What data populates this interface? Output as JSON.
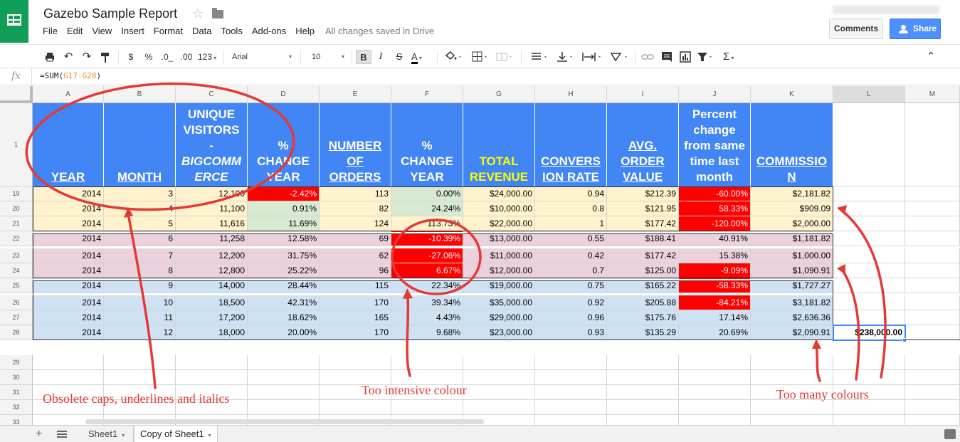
{
  "doc": {
    "title": "Gazebo Sample Report",
    "menu": [
      "File",
      "Edit",
      "View",
      "Insert",
      "Format",
      "Data",
      "Tools",
      "Add-ons",
      "Help"
    ],
    "save_status": "All changes saved in Drive",
    "comments_label": "Comments",
    "share_label": "Share"
  },
  "toolbar": {
    "currency": "$",
    "percent": "%",
    "dec_less": ".0_",
    "dec_more": ".00",
    "more_formats": "123",
    "font": "Arial",
    "font_size": "10",
    "bold": "B",
    "italic": "I",
    "strike": "S",
    "text_color": "A"
  },
  "formula": {
    "fx": "fx",
    "prefix": "=SUM(",
    "ref": "G17:G28",
    "suffix": ")"
  },
  "columns": [
    "A",
    "B",
    "C",
    "D",
    "E",
    "F",
    "G",
    "H",
    "I",
    "J",
    "K",
    "L",
    "M"
  ],
  "header_row": {
    "number": "1",
    "cells": [
      {
        "lines": [
          "YEAR"
        ]
      },
      {
        "lines": [
          "MONTH"
        ]
      },
      {
        "lines": [
          "UNIQUE",
          "VISITORS",
          "-",
          "BIGCOMM",
          "ERCE"
        ]
      },
      {
        "lines": [
          "%",
          "CHANGE",
          "YEAR"
        ]
      },
      {
        "lines": [
          "NUMBER",
          "OF",
          "ORDERS"
        ]
      },
      {
        "lines": [
          "%",
          "CHANGE",
          "YEAR"
        ]
      },
      {
        "lines": [
          "TOTAL",
          "REVENUE"
        ]
      },
      {
        "lines": [
          "CONVERS",
          "ION RATE"
        ]
      },
      {
        "lines": [
          "AVG.",
          "ORDER",
          "VALUE"
        ]
      },
      {
        "lines": [
          "Percent",
          "change",
          "from same",
          "time last",
          "month"
        ]
      },
      {
        "lines": [
          "COMMISSIO",
          "N"
        ]
      }
    ]
  },
  "rows": [
    {
      "n": "19",
      "v": [
        "2014",
        "3",
        "12,100",
        "-2.42%",
        "113",
        "0.00%",
        "$24,000.00",
        "0.94",
        "$212.39",
        "-60.00%",
        "$2,181.82"
      ]
    },
    {
      "n": "20",
      "v": [
        "2014",
        "4",
        "11,100",
        "0.91%",
        "82",
        "24.24%",
        "$10,000.00",
        "0.8",
        "$121.95",
        "58.33%",
        "$909.09"
      ]
    },
    {
      "n": "21",
      "v": [
        "2014",
        "5",
        "11,616",
        "11.69%",
        "124",
        "113.73%",
        "$22,000.00",
        "1",
        "$177.42",
        "-120.00%",
        "$2,000.00"
      ]
    },
    {
      "n": "22",
      "v": [
        "2014",
        "6",
        "11,258",
        "12.58%",
        "69",
        "-10.39%",
        "$13,000.00",
        "0.55",
        "$188.41",
        "40.91%",
        "$1,181.82"
      ]
    },
    {
      "n": "23",
      "v": [
        "2014",
        "7",
        "12,200",
        "31.75%",
        "62",
        "-27.06%",
        "$11,000.00",
        "0.42",
        "$177.42",
        "15.38%",
        "$1,000.00"
      ]
    },
    {
      "n": "24",
      "v": [
        "2014",
        "8",
        "12,800",
        "25.22%",
        "96",
        "6.67%",
        "$12,000.00",
        "0.7",
        "$125.00",
        "-9.09%",
        "$1,090.91"
      ]
    },
    {
      "n": "25",
      "v": [
        "2014",
        "9",
        "14,000",
        "28.44%",
        "115",
        "22.34%",
        "$19,000.00",
        "0.75",
        "$165.22",
        "-58.33%",
        "$1,727.27"
      ]
    },
    {
      "n": "26",
      "v": [
        "2014",
        "10",
        "18,500",
        "42.31%",
        "170",
        "39.34%",
        "$35,000.00",
        "0.92",
        "$205.88",
        "-84.21%",
        "$3,181.82"
      ]
    },
    {
      "n": "27",
      "v": [
        "2014",
        "11",
        "17,200",
        "18.62%",
        "165",
        "4.43%",
        "$29,000.00",
        "0.96",
        "$175.76",
        "17.14%",
        "$2,636.36"
      ]
    },
    {
      "n": "28",
      "v": [
        "2014",
        "12",
        "18,000",
        "20.00%",
        "170",
        "9.68%",
        "$23,000.00",
        "0.93",
        "$135.29",
        "20.69%",
        "$2,090.91"
      ]
    }
  ],
  "selected_value": "$238,000.00",
  "empty_rows": [
    "29",
    "30",
    "31",
    "32",
    "33"
  ],
  "colors": {
    "header_blue": "#4285f4",
    "yellow": "#fff2cc",
    "pink": "#ead1dc",
    "blue": "#cfe2f3",
    "green": "#d9ead3",
    "red": "#ff0000",
    "annotation": "#e53935"
  },
  "sheets": [
    "Sheet1",
    "Copy of Sheet1"
  ],
  "annotations": {
    "caps": "Obsolete caps, underlines and italics",
    "intensive": "Too intensive colour",
    "many": "Too many colours"
  }
}
